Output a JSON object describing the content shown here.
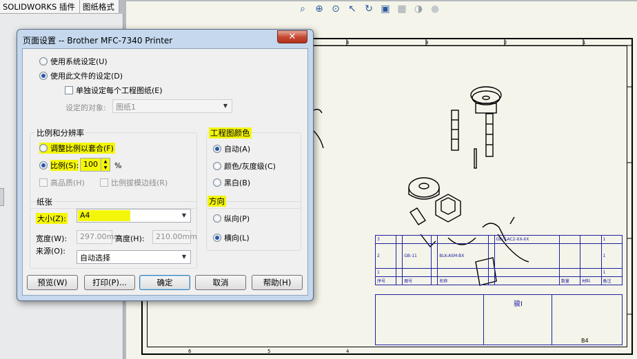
{
  "app": {
    "tabs": [
      "SOLIDWORKS 插件",
      "图纸格式"
    ],
    "toolbar_icons": [
      "zoom-to-fit-icon",
      "zoom-area-icon",
      "zoom-in-out-icon",
      "select-icon",
      "rotate-icon",
      "display-pane-icon",
      "view-orientation-icon",
      "display-style-icon",
      "hide-show-icon",
      "appearance-icon"
    ]
  },
  "sheet": {
    "top_zones": [
      "4",
      "3",
      "2",
      "1"
    ],
    "bottom_zones": [
      "6",
      "5",
      "4"
    ]
  },
  "title_block": {
    "rows": [
      [
        "3",
        "",
        "",
        "",
        "",
        "",
        "GB/T-AC2-XX-XX",
        "",
        "",
        "1"
      ],
      [
        "2",
        "",
        "GB-11",
        "",
        "BLK-ASM-BX",
        "",
        "",
        "",
        "",
        "1"
      ],
      [
        "1",
        "",
        "",
        "",
        "",
        "",
        "",
        "",
        "",
        "1"
      ],
      [
        "序号",
        "",
        "图号",
        "",
        "名称",
        "",
        "",
        "数量",
        "材料",
        "备注"
      ]
    ],
    "sheet_size": "B4",
    "company_mark": "骏I"
  },
  "dialog": {
    "title": "页面设置 -- Brother MFC-7340 Printer",
    "close_glyph": "✕",
    "settings_source": {
      "use_system": "使用系统设定(U)",
      "use_document": "使用此文件的设定(D)",
      "per_sheet": "单独设定每个工程图纸(E)",
      "target_label": "设定的对象:",
      "target_value": "图纸1"
    },
    "scale": {
      "group_title": "比例和分辨率",
      "fit": "调整比例以套合(F)",
      "scale_label": "比例(S):",
      "scale_value": "100",
      "percent": "%",
      "high_quality": "高品质(H)",
      "scale_line_weights": "比例拔模边线(R)"
    },
    "color": {
      "group_title": "工程图颜色",
      "auto": "自动(A)",
      "color_gray": "颜色/灰度级(C)",
      "bw": "黑白(B)"
    },
    "paper": {
      "group_title": "纸张",
      "size_label": "大小(Z):",
      "size_value": "A4",
      "width_label": "宽度(W):",
      "width_value": "297.00mm",
      "height_label": "高度(H):",
      "height_value": "210.00mm",
      "source_label": "来源(O):",
      "source_value": "自动选择"
    },
    "orientation": {
      "group_title": "方向",
      "portrait": "纵向(P)",
      "landscape": "横向(L)"
    },
    "buttons": {
      "preview": "预览(W)",
      "print": "打印(P)...",
      "ok": "确定",
      "cancel": "取消",
      "help": "帮助(H)"
    }
  }
}
